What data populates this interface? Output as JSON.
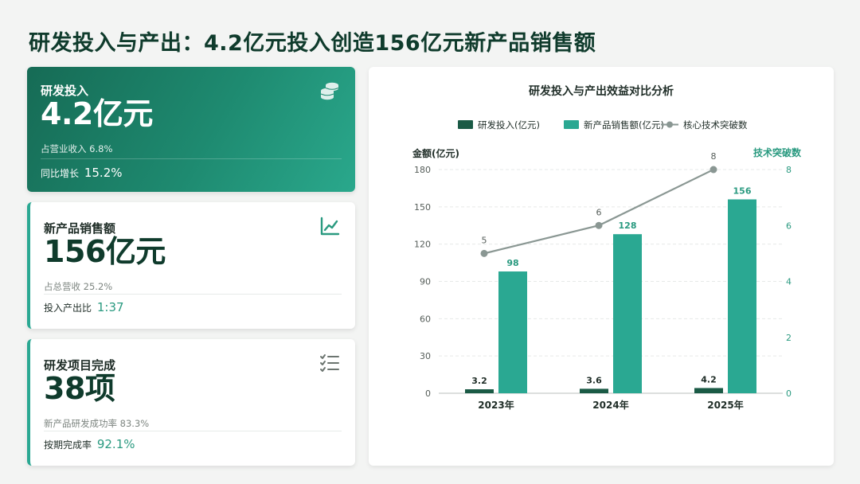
{
  "title": "研发投入与产出：4.2亿元投入创造156亿元新产品销售额",
  "cards": [
    {
      "label": "研发投入",
      "value": "4.2亿元",
      "sub": "占营业收入 6.8%",
      "metric_label": "同比增长",
      "metric_value": "15.2%",
      "icon": "coins-icon"
    },
    {
      "label": "新产品销售额",
      "value": "156亿元",
      "sub": "占总营收 25.2%",
      "metric_label": "投入产出比",
      "metric_value": "1:37",
      "icon": "line-chart-icon"
    },
    {
      "label": "研发项目完成",
      "value": "38项",
      "sub": "新产品研发成功率 83.3%",
      "metric_label": "按期完成率",
      "metric_value": "92.1%",
      "icon": "checklist-icon"
    }
  ],
  "colors": {
    "dark_green": "#1a5a45",
    "teal": "#2aa892",
    "line_gray": "#8a9793",
    "title_green": "#0f3b2c",
    "accent_teal": "#2a9a80"
  },
  "chart_data": {
    "type": "bar",
    "title": "研发投入与产出效益对比分析",
    "categories": [
      "2023年",
      "2024年",
      "2025年"
    ],
    "series": [
      {
        "name": "研发投入(亿元)",
        "type": "bar",
        "axis": "left",
        "values": [
          3.2,
          3.6,
          4.2
        ]
      },
      {
        "name": "新产品销售额(亿元)",
        "type": "bar",
        "axis": "left",
        "values": [
          98,
          128,
          156
        ]
      },
      {
        "name": "核心技术突破数",
        "type": "line",
        "axis": "right",
        "values": [
          5,
          6,
          8
        ]
      }
    ],
    "ylabel": "金额(亿元)",
    "y2label": "技术突破数",
    "ylim": [
      0,
      180
    ],
    "y2lim": [
      0,
      8
    ],
    "yticks": [
      0,
      30,
      60,
      90,
      120,
      150,
      180
    ],
    "y2ticks": [
      0,
      2,
      4,
      6,
      8
    ],
    "grid": true,
    "legend": "top-center"
  }
}
